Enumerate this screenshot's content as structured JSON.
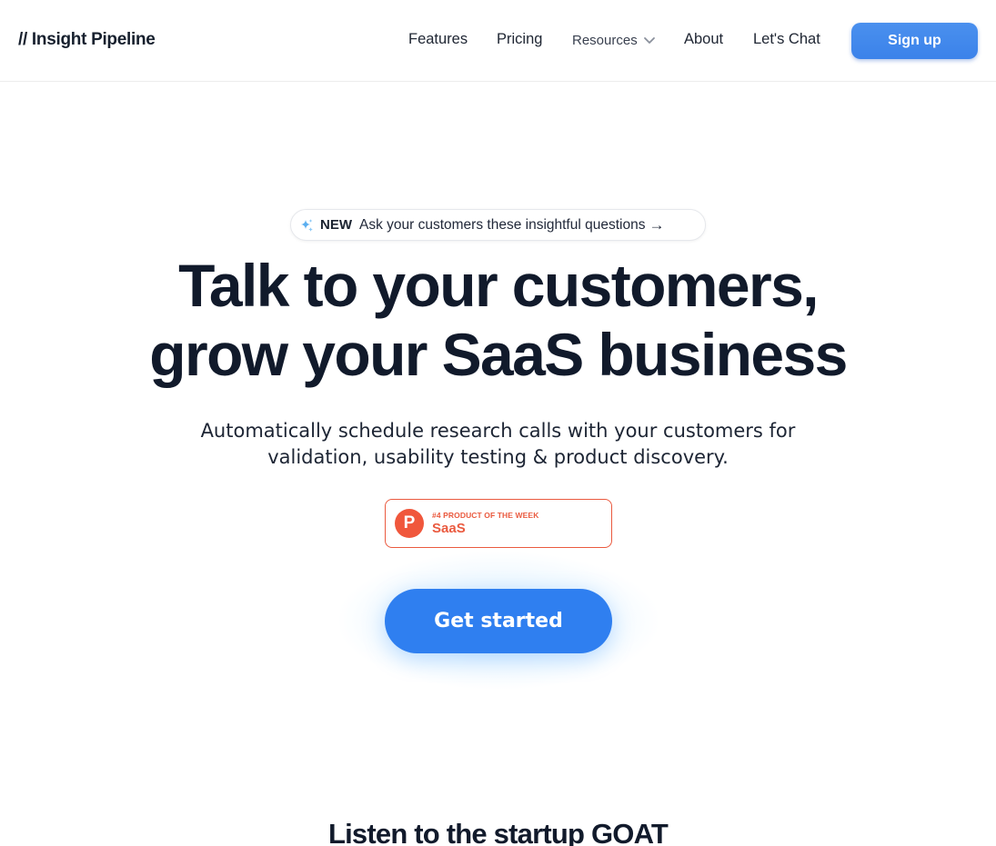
{
  "header": {
    "logo": "// Insight Pipeline",
    "nav": {
      "features": "Features",
      "pricing": "Pricing",
      "resources": "Resources",
      "about": "About",
      "chat": "Let's Chat"
    },
    "signup_label": "Sign up"
  },
  "announcement": {
    "tag": "NEW",
    "text": "Ask your customers these insightful questions",
    "arrow": "→"
  },
  "hero": {
    "headline_line1": "Talk to your customers,",
    "headline_line2": "grow your SaaS business",
    "sub_line1": "Automatically schedule research calls with your customers for",
    "sub_line2": "validation, usability testing & product discovery."
  },
  "badge": {
    "logo_letter": "P",
    "rank_text": "#4 PRODUCT OF THE WEEK",
    "category": "SaaS"
  },
  "cta": {
    "label": "Get started"
  },
  "next_section": {
    "title": "Listen to the startup GOAT"
  },
  "colors": {
    "accent": "#2f7ff0",
    "badge": "#ea5a3f",
    "text": "#111a2b"
  }
}
